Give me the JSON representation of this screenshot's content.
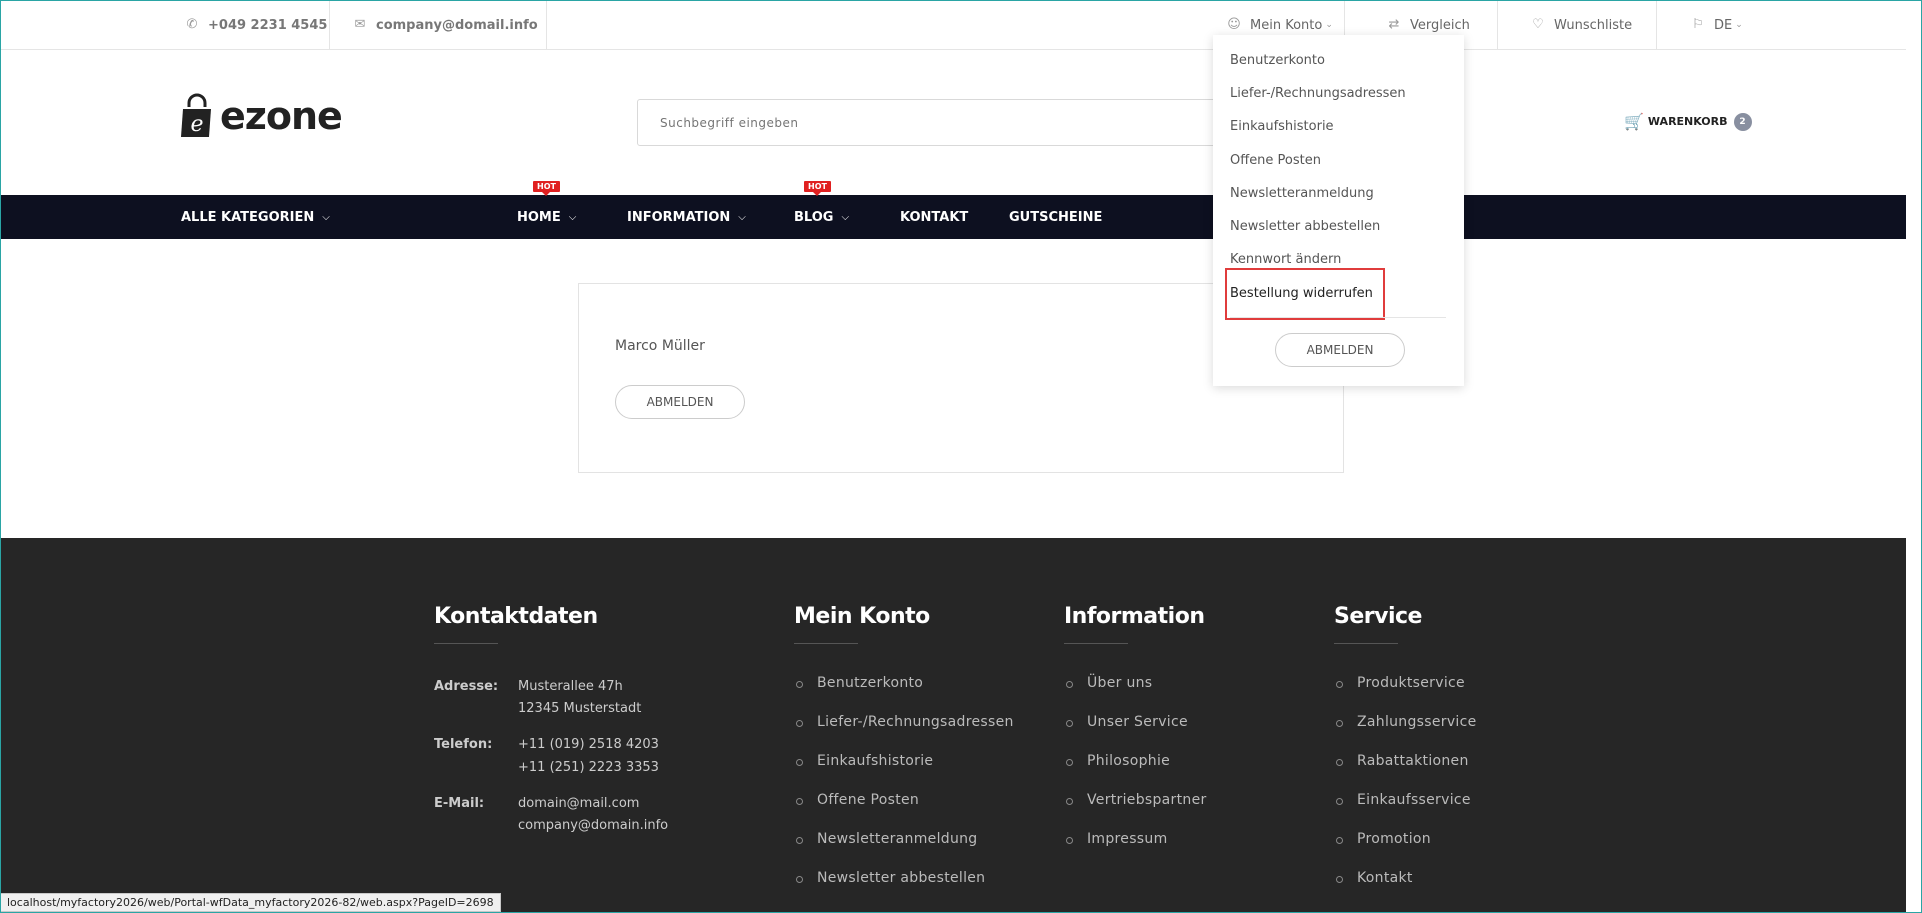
{
  "topbar": {
    "phone": "+049 2231 4545",
    "email": "company@domail.info",
    "konto": "Mein Konto",
    "vergleich": "Vergleich",
    "wunschliste": "Wunschliste",
    "lang": "DE"
  },
  "header": {
    "logo": "ezone",
    "search_placeholder": "Suchbegriff eingeben",
    "cart_label": "WARENKORB",
    "cart_count": "2"
  },
  "nav": {
    "alle": "ALLE KATEGORIEN",
    "home": "HOME",
    "information": "INFORMATION",
    "blog": "BLOG",
    "kontakt": "KONTAKT",
    "gutscheine": "GUTSCHEINE",
    "hot": "HOT"
  },
  "content": {
    "user_name": "Marco Müller",
    "logout": "ABMELDEN"
  },
  "dropdown": {
    "items": [
      "Benutzerkonto",
      "Liefer-/Rechnungsadressen",
      "Einkaufshistorie",
      "Offene Posten",
      "Newsletteranmeldung",
      "Newsletter abbestellen",
      "Kennwort ändern",
      "Bestellung widerrufen"
    ],
    "logout": "ABMELDEN"
  },
  "footer": {
    "kontakt": {
      "title": "Kontaktdaten",
      "adresse_label": "Adresse:",
      "adresse_1": "Musterallee 47h",
      "adresse_2": "12345 Musterstadt",
      "telefon_label": "Telefon:",
      "telefon_1": "+11 (019) 2518 4203",
      "telefon_2": "+11 (251) 2223 3353",
      "email_label": "E-Mail:",
      "email_1": "domain@mail.com",
      "email_2": "company@domain.info"
    },
    "konto": {
      "title": "Mein Konto",
      "items": [
        "Benutzerkonto",
        "Liefer-/Rechnungsadressen",
        "Einkaufshistorie",
        "Offene Posten",
        "Newsletteranmeldung",
        "Newsletter abbestellen"
      ]
    },
    "information": {
      "title": "Information",
      "items": [
        "Über uns",
        "Unser Service",
        "Philosophie",
        "Vertriebspartner",
        "Impressum"
      ]
    },
    "service": {
      "title": "Service",
      "items": [
        "Produktservice",
        "Zahlungsservice",
        "Rabattaktionen",
        "Einkaufsservice",
        "Promotion",
        "Kontakt"
      ]
    }
  },
  "statusbar": {
    "url": "localhost/myfactory2026/web/Portal-wfData_myfactory2026-82/web.aspx?PageID=2698"
  }
}
